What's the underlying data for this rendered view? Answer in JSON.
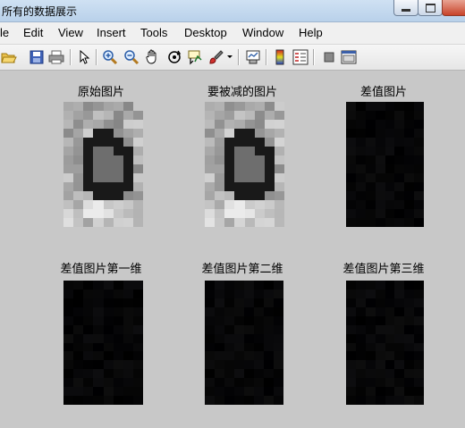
{
  "window": {
    "title": "所有的数据展示"
  },
  "menu": {
    "items": [
      "le",
      "Edit",
      "View",
      "Insert",
      "Tools",
      "Desktop",
      "Window",
      "Help"
    ]
  },
  "toolbar": {
    "icons": [
      "folder-open-icon",
      "save-icon",
      "print-icon",
      "pointer-icon",
      "zoom-in-icon",
      "zoom-out-icon",
      "pan-icon",
      "rotate-3d-icon",
      "data-cursor-icon",
      "brush-icon",
      "link-plot-icon",
      "colorbar-icon",
      "legend-icon",
      "hide-plot-tools-icon",
      "show-plot-tools-icon"
    ]
  },
  "figure": {
    "panels": [
      {
        "title": "原始图片"
      },
      {
        "title": "要被减的图片"
      },
      {
        "title": "差值图片"
      },
      {
        "title": "差值图片第一维"
      },
      {
        "title": "差值图片第二维"
      },
      {
        "title": "差值图片第三维"
      }
    ]
  }
}
